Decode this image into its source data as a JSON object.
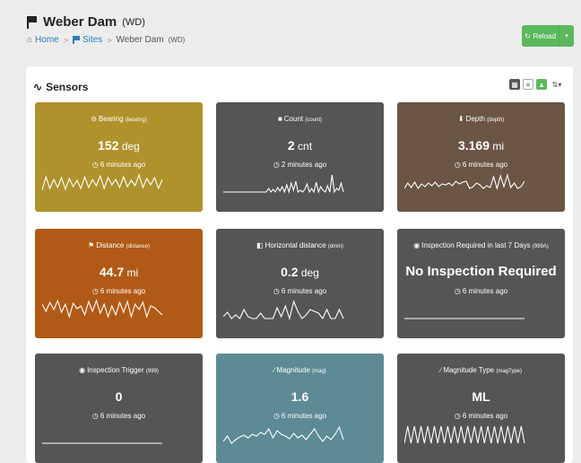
{
  "site": {
    "name": "Weber Dam",
    "code": "(WD)"
  },
  "breadcrumb": {
    "home": "Home",
    "sites": "Sites",
    "current": "Weber Dam",
    "current_code": "(WD)"
  },
  "reload": {
    "label": "Reload",
    "icon": "refresh-icon"
  },
  "panel": {
    "title": "Sensors",
    "icon": "pulse-icon"
  },
  "colors": {
    "gold": "#b0922c",
    "dark_gray": "#555555",
    "brown": "#6b5545",
    "orange": "#b15a17",
    "teal": "#5e8a96",
    "green": "#5cb85c",
    "link": "#2f7bbd"
  },
  "sensors": [
    {
      "name": "Bearing",
      "code": "(bearing)",
      "value": "152",
      "unit": "deg",
      "time": "6 minutes ago",
      "icon": "compass-icon",
      "color": "gold",
      "spark": [
        20,
        5,
        18,
        8,
        17,
        6,
        19,
        7,
        16,
        9,
        18,
        5,
        17,
        8,
        15,
        4,
        18,
        6,
        14,
        8,
        17,
        5,
        16,
        9,
        15,
        3,
        17,
        7,
        14,
        6,
        18,
        8
      ]
    },
    {
      "name": "Count",
      "code": "(count)",
      "value": "2",
      "unit": "cnt",
      "time": "2 minutes ago",
      "icon": "square-icon",
      "color": "dark_gray",
      "spark": [
        22,
        22,
        22,
        22,
        22,
        22,
        22,
        22,
        22,
        22,
        22,
        22,
        22,
        22,
        22,
        22,
        22,
        22,
        22,
        22,
        18,
        22,
        19,
        22,
        17,
        21,
        16,
        22,
        14,
        22,
        12,
        20,
        10,
        22,
        20,
        22,
        19,
        13,
        22,
        18,
        22,
        11,
        22,
        16,
        20,
        22,
        15,
        22,
        3,
        22,
        18,
        20,
        12,
        22
      ]
    },
    {
      "name": "Depth",
      "code": "(depth)",
      "value": "3.169",
      "unit": "mi",
      "time": "6 minutes ago",
      "icon": "down-arrow-icon",
      "color": "brown",
      "spark": [
        18,
        12,
        17,
        11,
        18,
        13,
        16,
        12,
        15,
        11,
        16,
        13,
        14,
        12,
        15,
        10,
        13,
        11,
        10,
        18,
        16,
        12,
        14,
        18,
        15,
        17,
        5,
        18,
        4,
        16,
        3,
        17,
        12,
        18,
        16,
        10
      ]
    },
    {
      "name": "Distance",
      "code": "(distance)",
      "value": "44.7",
      "unit": "mi",
      "time": "6 minutes ago",
      "icon": "pin-icon",
      "color": "orange",
      "spark": [
        6,
        14,
        4,
        12,
        2,
        15,
        6,
        20,
        5,
        11,
        8,
        18,
        3,
        14,
        2,
        16,
        6,
        20,
        8,
        18,
        4,
        15,
        3,
        20,
        6,
        12,
        4,
        20,
        8,
        10,
        14,
        18
      ]
    },
    {
      "name": "Horizontal distance",
      "code": "(dmin)",
      "value": "0.2",
      "unit": "deg",
      "time": "6 minutes ago",
      "icon": "half-square-icon",
      "color": "dark_gray",
      "spark": [
        20,
        15,
        22,
        18,
        22,
        12,
        20,
        22,
        22,
        16,
        22,
        22,
        22,
        10,
        20,
        8,
        22,
        3,
        14,
        22,
        18,
        12,
        14,
        16,
        22,
        12,
        22,
        22,
        12,
        22
      ]
    },
    {
      "name": "Inspection Required in last 7 Days",
      "code": "(999A)",
      "value": "No Inspection Required",
      "unit": "",
      "time": "6 minutes ago",
      "icon": "circle-dot-icon",
      "color": "dark_gray",
      "spark": []
    },
    {
      "name": "Inspection Trigger",
      "code": "(999)",
      "value": "0",
      "unit": "",
      "time": "6 minutes ago",
      "icon": "circle-dot-icon",
      "color": "dark_gray",
      "spark": []
    },
    {
      "name": "Magnitude",
      "code": "(mag)",
      "value": "1.6",
      "unit": "",
      "time": "6 minutes ago",
      "icon": "slash-icon",
      "color": "teal",
      "spark": [
        20,
        14,
        22,
        18,
        15,
        13,
        16,
        12,
        14,
        10,
        12,
        6,
        16,
        8,
        12,
        14,
        17,
        11,
        16,
        13,
        18,
        12,
        6,
        14,
        20,
        14,
        18,
        12,
        4,
        18
      ]
    },
    {
      "name": "Magnitude Type",
      "code": "(magType)",
      "value": "ML",
      "unit": "",
      "time": "6 minutes ago",
      "icon": "slash-icon",
      "color": "dark_gray",
      "spark": [
        22,
        3,
        22,
        3,
        22,
        3,
        22,
        3,
        22,
        3,
        22,
        3,
        22,
        3,
        22,
        3,
        22,
        3,
        22,
        3,
        22,
        3,
        22,
        3,
        22,
        3,
        22,
        3,
        22,
        3,
        22,
        3,
        22,
        3,
        22,
        3,
        22
      ]
    }
  ]
}
